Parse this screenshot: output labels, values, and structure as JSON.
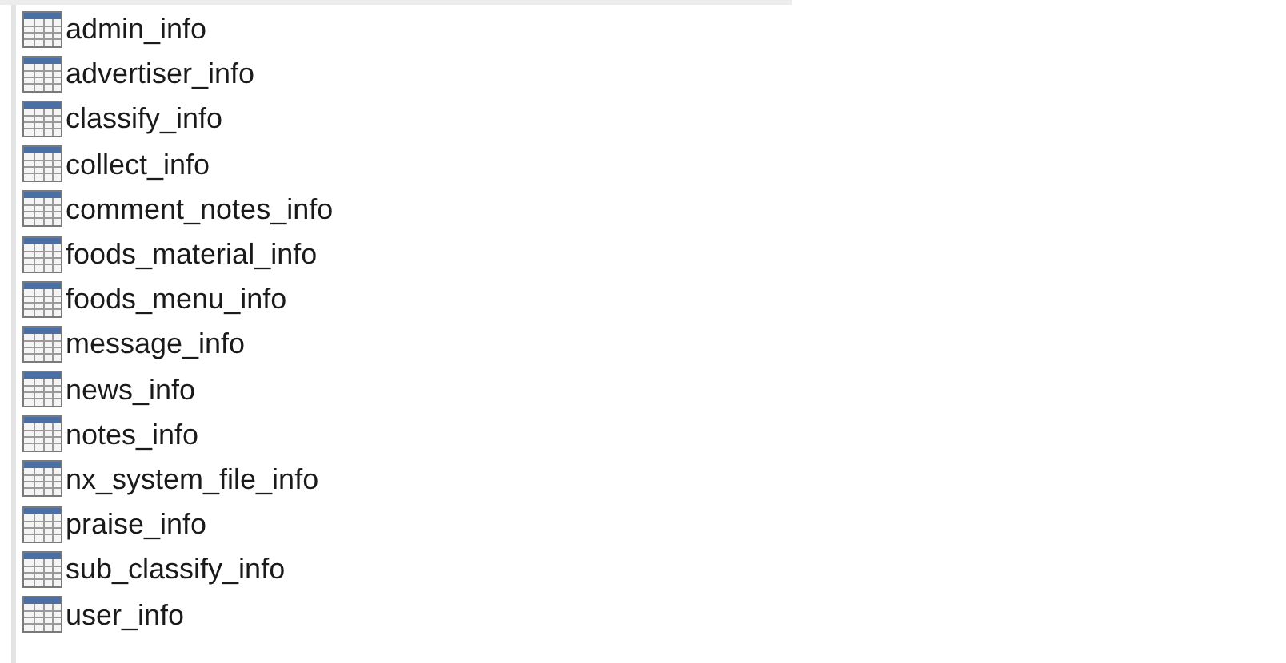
{
  "tables": [
    {
      "name": "admin_info"
    },
    {
      "name": "advertiser_info"
    },
    {
      "name": "classify_info"
    },
    {
      "name": "collect_info"
    },
    {
      "name": "comment_notes_info"
    },
    {
      "name": "foods_material_info"
    },
    {
      "name": "foods_menu_info"
    },
    {
      "name": "message_info"
    },
    {
      "name": "news_info"
    },
    {
      "name": "notes_info"
    },
    {
      "name": "nx_system_file_info"
    },
    {
      "name": "praise_info"
    },
    {
      "name": "sub_classify_info"
    },
    {
      "name": "user_info"
    }
  ]
}
